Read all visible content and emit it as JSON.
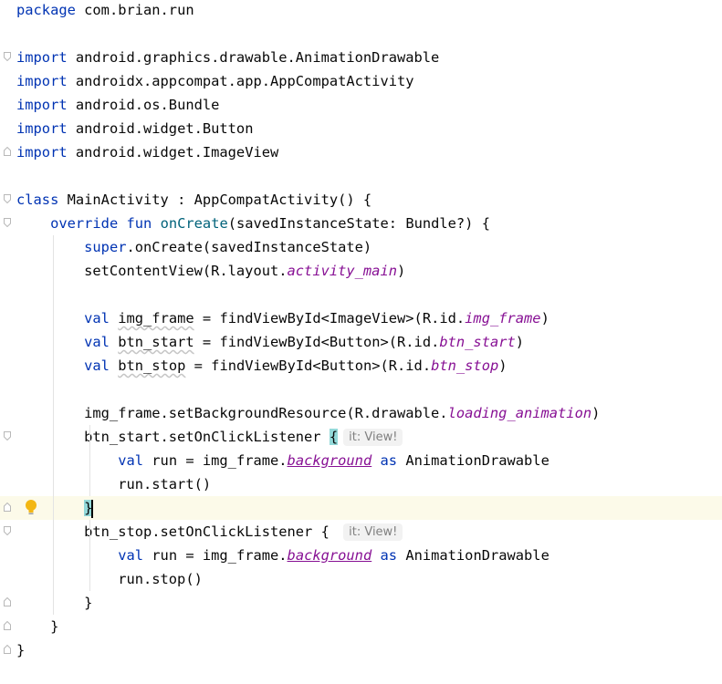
{
  "editor": {
    "file_language": "Kotlin",
    "lines": [
      {
        "tokens": [
          {
            "t": "package",
            "c": "kw"
          },
          {
            "t": " com.brian.run",
            "c": "plain"
          }
        ]
      },
      {
        "tokens": []
      },
      {
        "fold": "open",
        "tokens": [
          {
            "t": "import",
            "c": "kw"
          },
          {
            "t": " android.graphics.drawable.AnimationDrawable",
            "c": "plain"
          }
        ]
      },
      {
        "tokens": [
          {
            "t": "import",
            "c": "kw"
          },
          {
            "t": " androidx.appcompat.app.AppCompatActivity",
            "c": "plain"
          }
        ]
      },
      {
        "tokens": [
          {
            "t": "import",
            "c": "kw"
          },
          {
            "t": " android.os.Bundle",
            "c": "plain"
          }
        ]
      },
      {
        "tokens": [
          {
            "t": "import",
            "c": "kw"
          },
          {
            "t": " android.widget.Button",
            "c": "plain"
          }
        ]
      },
      {
        "fold": "end",
        "tokens": [
          {
            "t": "import",
            "c": "kw"
          },
          {
            "t": " android.widget.ImageView",
            "c": "plain"
          }
        ]
      },
      {
        "tokens": []
      },
      {
        "fold": "open",
        "tokens": [
          {
            "t": "class",
            "c": "kw"
          },
          {
            "t": " MainActivity : AppCompatActivity() {",
            "c": "plain"
          }
        ]
      },
      {
        "fold": "open",
        "tokens": [
          {
            "t": "    "
          },
          {
            "t": "override",
            "c": "kw"
          },
          {
            "t": " "
          },
          {
            "t": "fun",
            "c": "kw"
          },
          {
            "t": " "
          },
          {
            "t": "onCreate",
            "c": "fn"
          },
          {
            "t": "(savedInstanceState: Bundle?) {",
            "c": "plain"
          }
        ]
      },
      {
        "tokens": [
          {
            "t": "        "
          },
          {
            "t": "super",
            "c": "kw"
          },
          {
            "t": ".onCreate(savedInstanceState)",
            "c": "plain"
          }
        ]
      },
      {
        "tokens": [
          {
            "t": "        setContentView(R.layout.",
            "c": "plain"
          },
          {
            "t": "activity_main",
            "c": "prop"
          },
          {
            "t": ")",
            "c": "plain"
          }
        ]
      },
      {
        "tokens": []
      },
      {
        "tokens": [
          {
            "t": "        "
          },
          {
            "t": "val",
            "c": "kw"
          },
          {
            "t": " "
          },
          {
            "t": "img_frame",
            "c": "squig"
          },
          {
            "t": " = findViewById<ImageView>(R.id.",
            "c": "plain"
          },
          {
            "t": "img_frame",
            "c": "prop"
          },
          {
            "t": ")",
            "c": "plain"
          }
        ]
      },
      {
        "tokens": [
          {
            "t": "        "
          },
          {
            "t": "val",
            "c": "kw"
          },
          {
            "t": " "
          },
          {
            "t": "btn_start",
            "c": "squig"
          },
          {
            "t": " = findViewById<Button>(R.id.",
            "c": "plain"
          },
          {
            "t": "btn_start",
            "c": "prop"
          },
          {
            "t": ")",
            "c": "plain"
          }
        ]
      },
      {
        "tokens": [
          {
            "t": "        "
          },
          {
            "t": "val",
            "c": "kw"
          },
          {
            "t": " "
          },
          {
            "t": "btn_stop",
            "c": "squig"
          },
          {
            "t": " = findViewById<Button>(R.id.",
            "c": "plain"
          },
          {
            "t": "btn_stop",
            "c": "prop"
          },
          {
            "t": ")",
            "c": "plain"
          }
        ]
      },
      {
        "tokens": []
      },
      {
        "tokens": [
          {
            "t": "        img_frame.setBackgroundResource(R.drawable.",
            "c": "plain"
          },
          {
            "t": "loading_animation",
            "c": "prop"
          },
          {
            "t": ")",
            "c": "plain"
          }
        ]
      },
      {
        "fold": "open",
        "tokens": [
          {
            "t": "        btn_start.setOnClickListener ",
            "c": "plain"
          },
          {
            "t": "{",
            "c": "brace-match"
          },
          {
            "t": "it: View!",
            "c": "hint"
          }
        ]
      },
      {
        "tokens": [
          {
            "t": "            "
          },
          {
            "t": "val",
            "c": "kw"
          },
          {
            "t": " run = img_frame.",
            "c": "plain"
          },
          {
            "t": "background",
            "c": "ext"
          },
          {
            "t": " "
          },
          {
            "t": "as",
            "c": "kw"
          },
          {
            "t": " AnimationDrawable",
            "c": "plain"
          }
        ]
      },
      {
        "tokens": [
          {
            "t": "            run.start()",
            "c": "plain"
          }
        ]
      },
      {
        "fold": "end",
        "current": true,
        "bulb": true,
        "tokens": [
          {
            "t": "        "
          },
          {
            "t": "}",
            "c": "brace-match"
          },
          {
            "t": "",
            "c": "caret"
          }
        ]
      },
      {
        "fold": "open",
        "tokens": [
          {
            "t": "        btn_stop.setOnClickListener { ",
            "c": "plain"
          },
          {
            "t": "it: View!",
            "c": "hint"
          }
        ]
      },
      {
        "tokens": [
          {
            "t": "            "
          },
          {
            "t": "val",
            "c": "kw"
          },
          {
            "t": " run = img_frame.",
            "c": "plain"
          },
          {
            "t": "background",
            "c": "ext"
          },
          {
            "t": " "
          },
          {
            "t": "as",
            "c": "kw"
          },
          {
            "t": " AnimationDrawable",
            "c": "plain"
          }
        ]
      },
      {
        "tokens": [
          {
            "t": "            run.stop()",
            "c": "plain"
          }
        ]
      },
      {
        "fold": "end",
        "tokens": [
          {
            "t": "        }",
            "c": "plain"
          }
        ]
      },
      {
        "fold": "end",
        "tokens": [
          {
            "t": "    }",
            "c": "plain"
          }
        ]
      },
      {
        "fold": "end",
        "tokens": [
          {
            "t": "}",
            "c": "plain"
          }
        ]
      }
    ]
  },
  "colors": {
    "keyword": "#0033b3",
    "function": "#00627a",
    "property": "#871094",
    "plain": "#080808",
    "current_line": "#fcfae9",
    "brace_match": "#93d9d9"
  },
  "icons": {
    "fold_open": "fold-open-icon",
    "fold_end": "fold-end-icon",
    "intention": "lightbulb-icon"
  }
}
